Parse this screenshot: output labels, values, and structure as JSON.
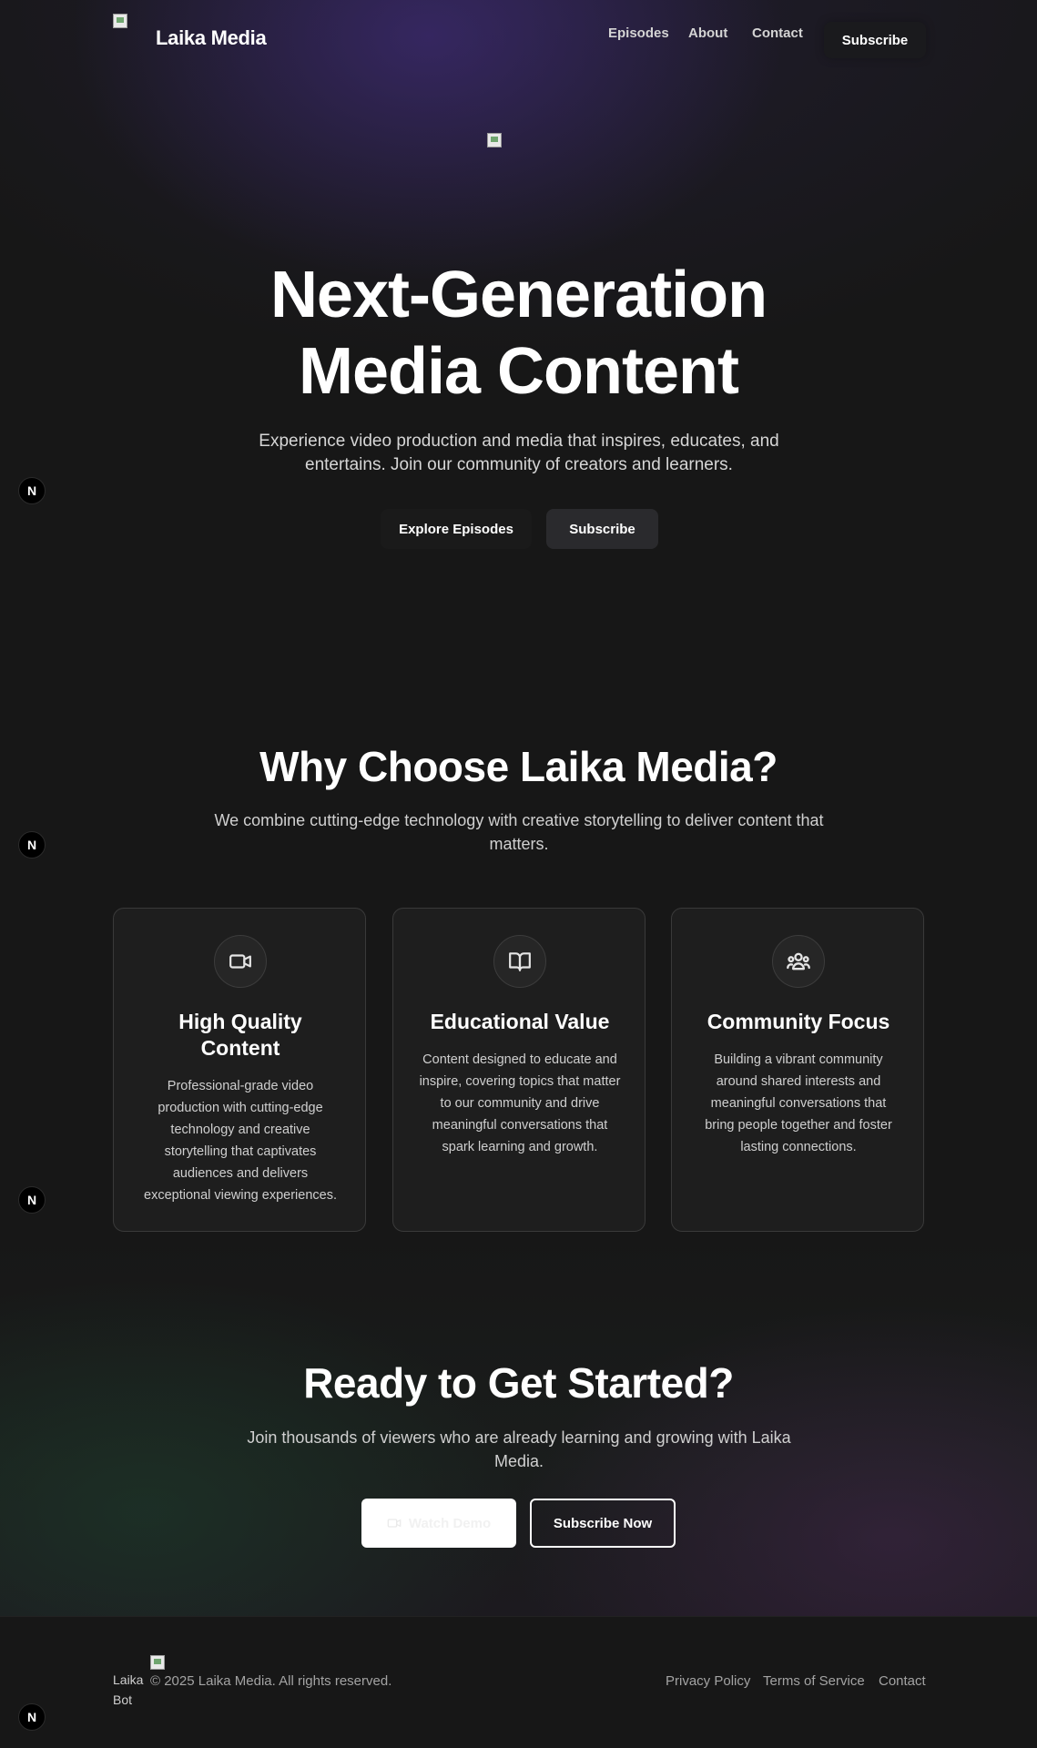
{
  "nav": {
    "brand": "Laika Media",
    "links": [
      "Episodes",
      "About",
      "Contact"
    ],
    "subscribe": "Subscribe"
  },
  "hero": {
    "title_line1": "Next-Generation",
    "title_line2": "Media Content",
    "text": "Experience video production and media that inspires, educates, and entertains. Join our community of creators and learners.",
    "explore": "Explore Episodes",
    "subscribe": "Subscribe"
  },
  "features": {
    "title": "Why Choose Laika Media?",
    "text": "We combine cutting-edge technology with creative storytelling to deliver content that matters.",
    "cards": [
      {
        "icon": "video-camera-icon",
        "title_line1": "High Quality",
        "title_line2": "Content",
        "text": "Professional-grade video production with cutting-edge technology and creative storytelling that captivates audiences and delivers exceptional viewing experiences."
      },
      {
        "icon": "book-open-icon",
        "title_line1": "Educational Value",
        "title_line2": "",
        "text": "Content designed to educate and inspire, covering topics that matter to our community and drive meaningful conversations that spark learning and growth."
      },
      {
        "icon": "users-group-icon",
        "title_line1": "Community Focus",
        "title_line2": "",
        "text": "Building a vibrant community around shared interests and meaningful conversations that bring people together and foster lasting connections."
      }
    ]
  },
  "cta": {
    "title": "Ready to Get Started?",
    "text": "Join thousands of viewers who are already learning and growing with Laika Media.",
    "watch": "Watch Demo",
    "subscribe_now": "Subscribe Now"
  },
  "footer": {
    "logo_alt": "Laika Bot",
    "copyright": "© 2025 Laika Media. All rights reserved.",
    "links": [
      "Privacy Policy",
      "Terms of Service",
      "Contact"
    ]
  },
  "badge_letter": "N"
}
